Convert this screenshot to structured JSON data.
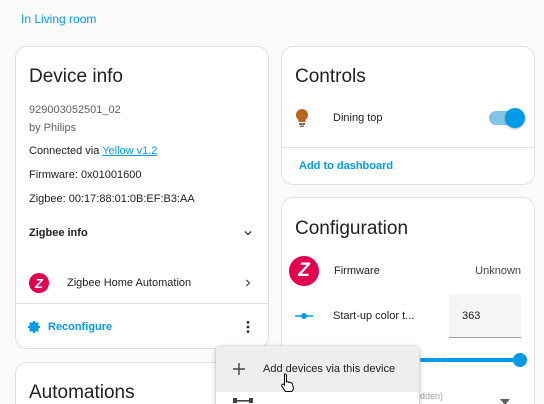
{
  "area_link": "In Living room",
  "device_info": {
    "title": "Device info",
    "model": "929003052501_02",
    "manufacturer": "by Philips",
    "connected_prefix": "Connected via ",
    "connected_link": "Yellow v1.2",
    "firmware": "Firmware: 0x01001600",
    "zigbee": "Zigbee: 00:17:88:01:0B:EF:B3:AA",
    "zigbee_info_label": "Zigbee info",
    "integration_name": "Zigbee Home Automation",
    "reconfigure_label": "Reconfigure"
  },
  "automations": {
    "title": "Automations"
  },
  "controls": {
    "title": "Controls",
    "entity_name": "Dining top",
    "toggle_on": true,
    "add_to_dashboard": "Add to dashboard"
  },
  "configuration": {
    "title": "Configuration",
    "firmware_label": "Firmware",
    "firmware_value": "Unknown",
    "startup_label": "Start-up color t...",
    "startup_value": "363",
    "slider_fraction": 1.0,
    "hidden_hint": "dden)"
  },
  "menu": {
    "items": [
      {
        "label": "Add devices via this device",
        "icon": "plus-icon"
      },
      {
        "label": "",
        "icon": "network-icon"
      }
    ]
  },
  "colors": {
    "accent": "#039be5",
    "zigbee_red": "#e2004f",
    "bulb": "#b5651d"
  }
}
